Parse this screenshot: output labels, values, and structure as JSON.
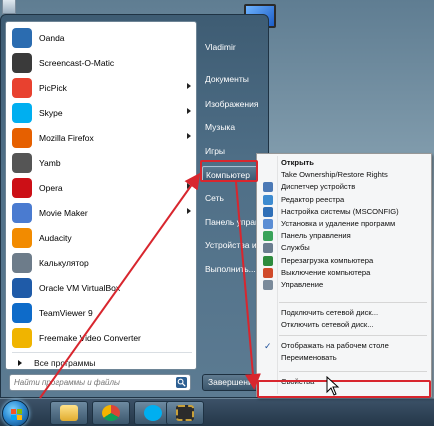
{
  "start_menu": {
    "programs": [
      {
        "label": "Oanda",
        "icon": "oanda-icon",
        "color": "#2b6cb0",
        "submenu": false
      },
      {
        "label": "Screencast-O-Matic",
        "icon": "screencast-icon",
        "color": "#3a3a3a",
        "submenu": false
      },
      {
        "label": "PicPick",
        "icon": "picpick-icon",
        "color": "#e8412f",
        "submenu": true
      },
      {
        "label": "Skype",
        "icon": "skype-icon",
        "color": "#00aff0",
        "submenu": true
      },
      {
        "label": "Mozilla Firefox",
        "icon": "firefox-icon",
        "color": "#e66000",
        "submenu": true
      },
      {
        "label": "Yamb",
        "icon": "yamb-icon",
        "color": "#555555",
        "submenu": false
      },
      {
        "label": "Opera",
        "icon": "opera-icon",
        "color": "#cc0f16",
        "submenu": true
      },
      {
        "label": "Movie Maker",
        "icon": "movie-maker-icon",
        "color": "#4a7bd0",
        "submenu": true
      },
      {
        "label": "Audacity",
        "icon": "audacity-icon",
        "color": "#f28b00",
        "submenu": false
      },
      {
        "label": "Калькулятор",
        "icon": "calculator-icon",
        "color": "#6d7c8a",
        "submenu": false
      },
      {
        "label": "Oracle VM VirtualBox",
        "icon": "virtualbox-icon",
        "color": "#1f5ba8",
        "submenu": false
      },
      {
        "label": "TeamViewer 9",
        "icon": "teamviewer-icon",
        "color": "#0e6bc9",
        "submenu": false
      },
      {
        "label": "Freemake Video Converter",
        "icon": "freemake-icon",
        "color": "#f0b400",
        "submenu": false
      }
    ],
    "all_programs": "Все программы",
    "search_placeholder": "Найти программы и файлы",
    "right_items": [
      {
        "label": "Vladimir",
        "highlighted": false
      },
      {
        "label": "Документы",
        "highlighted": false
      },
      {
        "label": "Изображения",
        "highlighted": false
      },
      {
        "label": "Музыка",
        "highlighted": false
      },
      {
        "label": "Игры",
        "highlighted": false
      },
      {
        "label": "Компьютер",
        "highlighted": true
      },
      {
        "label": "Сеть",
        "highlighted": false
      },
      {
        "label": "Панель управления",
        "highlighted": false
      },
      {
        "label": "Устройства и принтеры",
        "highlighted": false
      },
      {
        "label": "Выполнить...",
        "highlighted": false
      }
    ],
    "shutdown_label": "Завершение работы"
  },
  "context_menu": {
    "groups": [
      [
        {
          "label": "Открыть",
          "bold": true,
          "icon": "",
          "color": ""
        },
        {
          "label": "Take Ownership/Restore Rights",
          "icon": "",
          "color": ""
        },
        {
          "label": "Диспетчер устройств",
          "icon": "device-manager-icon",
          "color": "#4b79b6"
        },
        {
          "label": "Редактор реестра",
          "icon": "registry-editor-icon",
          "color": "#3d8bd0"
        },
        {
          "label": "Настройка системы (MSCONFIG)",
          "icon": "msconfig-icon",
          "color": "#2f6fb7"
        },
        {
          "label": "Установка и удаление программ",
          "icon": "programs-icon",
          "color": "#5a8dd4"
        },
        {
          "label": "Панель управления",
          "icon": "control-panel-icon",
          "color": "#3aa35a"
        },
        {
          "label": "Службы",
          "icon": "services-icon",
          "color": "#6a7d8f"
        },
        {
          "label": "Перезагрузка компьютера",
          "icon": "restart-icon",
          "color": "#2e8b3d"
        },
        {
          "label": "Выключение компьютера",
          "icon": "power-icon",
          "color": "#d04a2a"
        },
        {
          "label": "Управление",
          "icon": "manage-icon",
          "color": "#7a8a9a"
        }
      ],
      [
        {
          "label": "Подключить сетевой диск...",
          "icon": "",
          "color": ""
        },
        {
          "label": "Отключить сетевой диск...",
          "icon": "",
          "color": ""
        }
      ],
      [
        {
          "label": "Отображать на рабочем столе",
          "icon": "check-icon",
          "color": ""
        },
        {
          "label": "Переименовать",
          "icon": "",
          "color": ""
        }
      ],
      [
        {
          "label": "Свойства",
          "icon": "",
          "color": ""
        }
      ]
    ]
  },
  "accent": {
    "annotation_red": "#d8262e"
  }
}
